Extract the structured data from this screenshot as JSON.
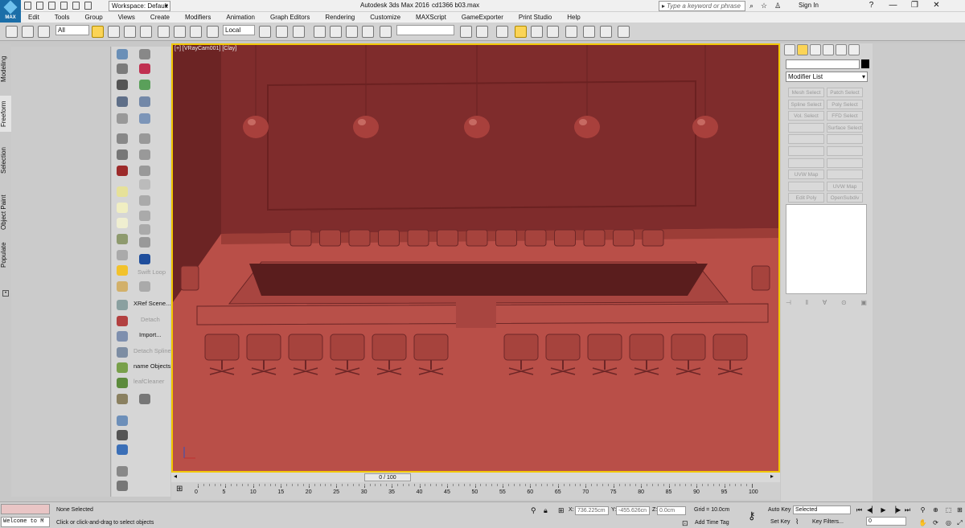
{
  "app": {
    "title": "Autodesk 3ds Max 2016",
    "document": "cd1366 b03.max",
    "logo_text": "MAX",
    "workspace": "Workspace: Default",
    "search_placeholder": "Type a keyword or phrase",
    "sign_in": "Sign In"
  },
  "menu": [
    "Edit",
    "Tools",
    "Group",
    "Views",
    "Create",
    "Modifiers",
    "Animation",
    "Graph Editors",
    "Rendering",
    "Customize",
    "MAXScript",
    "GameExporter",
    "Print Studio",
    "Help"
  ],
  "main_toolbar": {
    "selection_filter": "All",
    "ref_coord": "Local"
  },
  "command_tabs": [
    "Modeling",
    "Freeform",
    "Selection",
    "Object Paint",
    "Populate"
  ],
  "ribbon": {
    "swift_loop": "Swift Loop",
    "xref": "XRef Scene...",
    "detach": "Detach",
    "import": "Import...",
    "detach_spline": "Detach Spline",
    "rename": "name Objects",
    "leaf_cleaner": "leafCleaner"
  },
  "viewport": {
    "label": "[+] [VRayCam001] [Clay]",
    "render_color": "#7f2c2c"
  },
  "cmd_panel": {
    "modifier_list": "Modifier List",
    "buttons": [
      [
        "Mesh Select",
        "Patch Select"
      ],
      [
        "Spline Select",
        "Poly Select"
      ],
      [
        "Vol. Select",
        "FFD Select"
      ],
      [
        "",
        "Surface Select"
      ],
      [
        "",
        ""
      ],
      [
        "",
        ""
      ],
      [
        "",
        ""
      ],
      [
        "UVW Map",
        ""
      ],
      [
        "",
        "UVW Map"
      ],
      [
        "Edit Poly",
        "OpenSubdiv"
      ]
    ]
  },
  "time": {
    "slider": "0 / 100",
    "ticks": [
      "0",
      "5",
      "10",
      "15",
      "20",
      "25",
      "30",
      "35",
      "40",
      "45",
      "50",
      "55",
      "60",
      "65",
      "70",
      "75",
      "80",
      "85",
      "90",
      "95",
      "100"
    ]
  },
  "status": {
    "selection": "None Selected",
    "prompt": "Click or click-and-drag to select objects",
    "welcome": "Welcome to M",
    "x_label": "X:",
    "x": "736.225cm",
    "y_label": "Y:",
    "y": "-455.626cn",
    "z_label": "Z:",
    "z": "0.0cm",
    "grid": "Grid = 10.0cm",
    "add_time_tag": "Add Time Tag",
    "auto_key": "Auto Key",
    "set_key": "Set Key",
    "key_mode": "Selected",
    "key_filters": "Key Filters...",
    "frame": "0"
  }
}
